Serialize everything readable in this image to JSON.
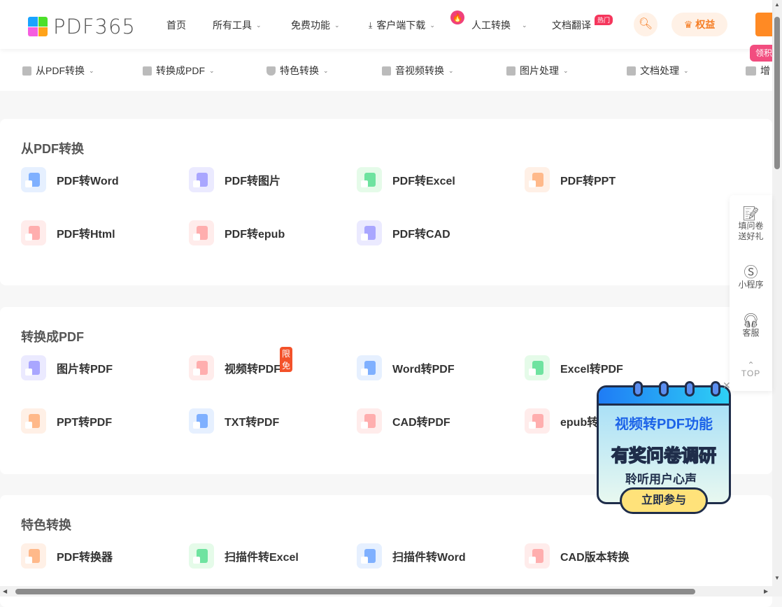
{
  "header": {
    "logo_text": "PDF365",
    "nav": [
      {
        "label": "首页"
      },
      {
        "label": "所有工具",
        "dropdown": true
      },
      {
        "label": "免费功能",
        "dropdown": true
      },
      {
        "label": "客户端下载",
        "dropdown": true,
        "icon": "download-icon"
      },
      {
        "label": "人工转换",
        "dropdown": true,
        "icon": "fire-icon"
      },
      {
        "label": "文档翻译",
        "badge": "热门"
      }
    ],
    "rights_label": "权益",
    "promo_tag": "领积"
  },
  "subnav": [
    {
      "label": "从PDF转换"
    },
    {
      "label": "转换成PDF"
    },
    {
      "label": "特色转换"
    },
    {
      "label": "音视频转换"
    },
    {
      "label": "图片处理"
    },
    {
      "label": "文档处理"
    },
    {
      "label": "增"
    }
  ],
  "sections": [
    {
      "title": "从PDF转换",
      "items": [
        {
          "label": "PDF转Word",
          "color": "#7fb0ff",
          "bg": "#e6f0ff"
        },
        {
          "label": "PDF转图片",
          "color": "#a9a6ff",
          "bg": "#ebeaff"
        },
        {
          "label": "PDF转Excel",
          "color": "#6fe3a0",
          "bg": "#e5fbe9"
        },
        {
          "label": "PDF转PPT",
          "color": "#ffb98a",
          "bg": "#fff0e6"
        },
        {
          "label": "PDF转Html",
          "color": "#ffaeae",
          "bg": "#ffeceb"
        },
        {
          "label": "PDF转epub",
          "color": "#ffaeae",
          "bg": "#ffeceb"
        },
        {
          "label": "PDF转CAD",
          "color": "#a9a6ff",
          "bg": "#ebeaff"
        }
      ]
    },
    {
      "title": "转换成PDF",
      "items": [
        {
          "label": "图片转PDF",
          "color": "#a9a6ff",
          "bg": "#ebeaff"
        },
        {
          "label": "视频转PDF",
          "color": "#ffaeae",
          "bg": "#ffeceb",
          "badge": "限免"
        },
        {
          "label": "Word转PDF",
          "color": "#7fb0ff",
          "bg": "#e6f0ff"
        },
        {
          "label": "Excel转PDF",
          "color": "#6fe3a0",
          "bg": "#e5fbe9"
        },
        {
          "label": "PPT转PDF",
          "color": "#ffb98a",
          "bg": "#fff0e6"
        },
        {
          "label": "TXT转PDF",
          "color": "#7fb0ff",
          "bg": "#e6f0ff"
        },
        {
          "label": "CAD转PDF",
          "color": "#ffaeae",
          "bg": "#ffeceb"
        },
        {
          "label": "epub转PDF",
          "color": "#ffaeae",
          "bg": "#ffeceb"
        }
      ]
    },
    {
      "title": "特色转换",
      "items": [
        {
          "label": "PDF转换器",
          "color": "#ffb98a",
          "bg": "#fff0e6"
        },
        {
          "label": "扫描件转Excel",
          "color": "#6fe3a0",
          "bg": "#e5fbe9"
        },
        {
          "label": "扫描件转Word",
          "color": "#7fb0ff",
          "bg": "#e6f0ff"
        },
        {
          "label": "CAD版本转换",
          "color": "#ffaeae",
          "bg": "#ffeceb"
        }
      ]
    }
  ],
  "side_panel": [
    {
      "label": "填问卷送好礼",
      "icon": "survey-icon"
    },
    {
      "label": "小程序",
      "icon": "mini-program-icon"
    },
    {
      "label": "客服",
      "icon": "headset-icon"
    },
    {
      "label": "TOP",
      "icon": "chevron-up-icon"
    }
  ],
  "popup": {
    "line1": "视频转PDF功能",
    "line2": "有奖问卷调研",
    "line3": "聆听用户心声",
    "button": "立即参与"
  },
  "colors": {
    "accent": "#f57c22",
    "hot": "#f5365c",
    "free": "#f3522a"
  }
}
